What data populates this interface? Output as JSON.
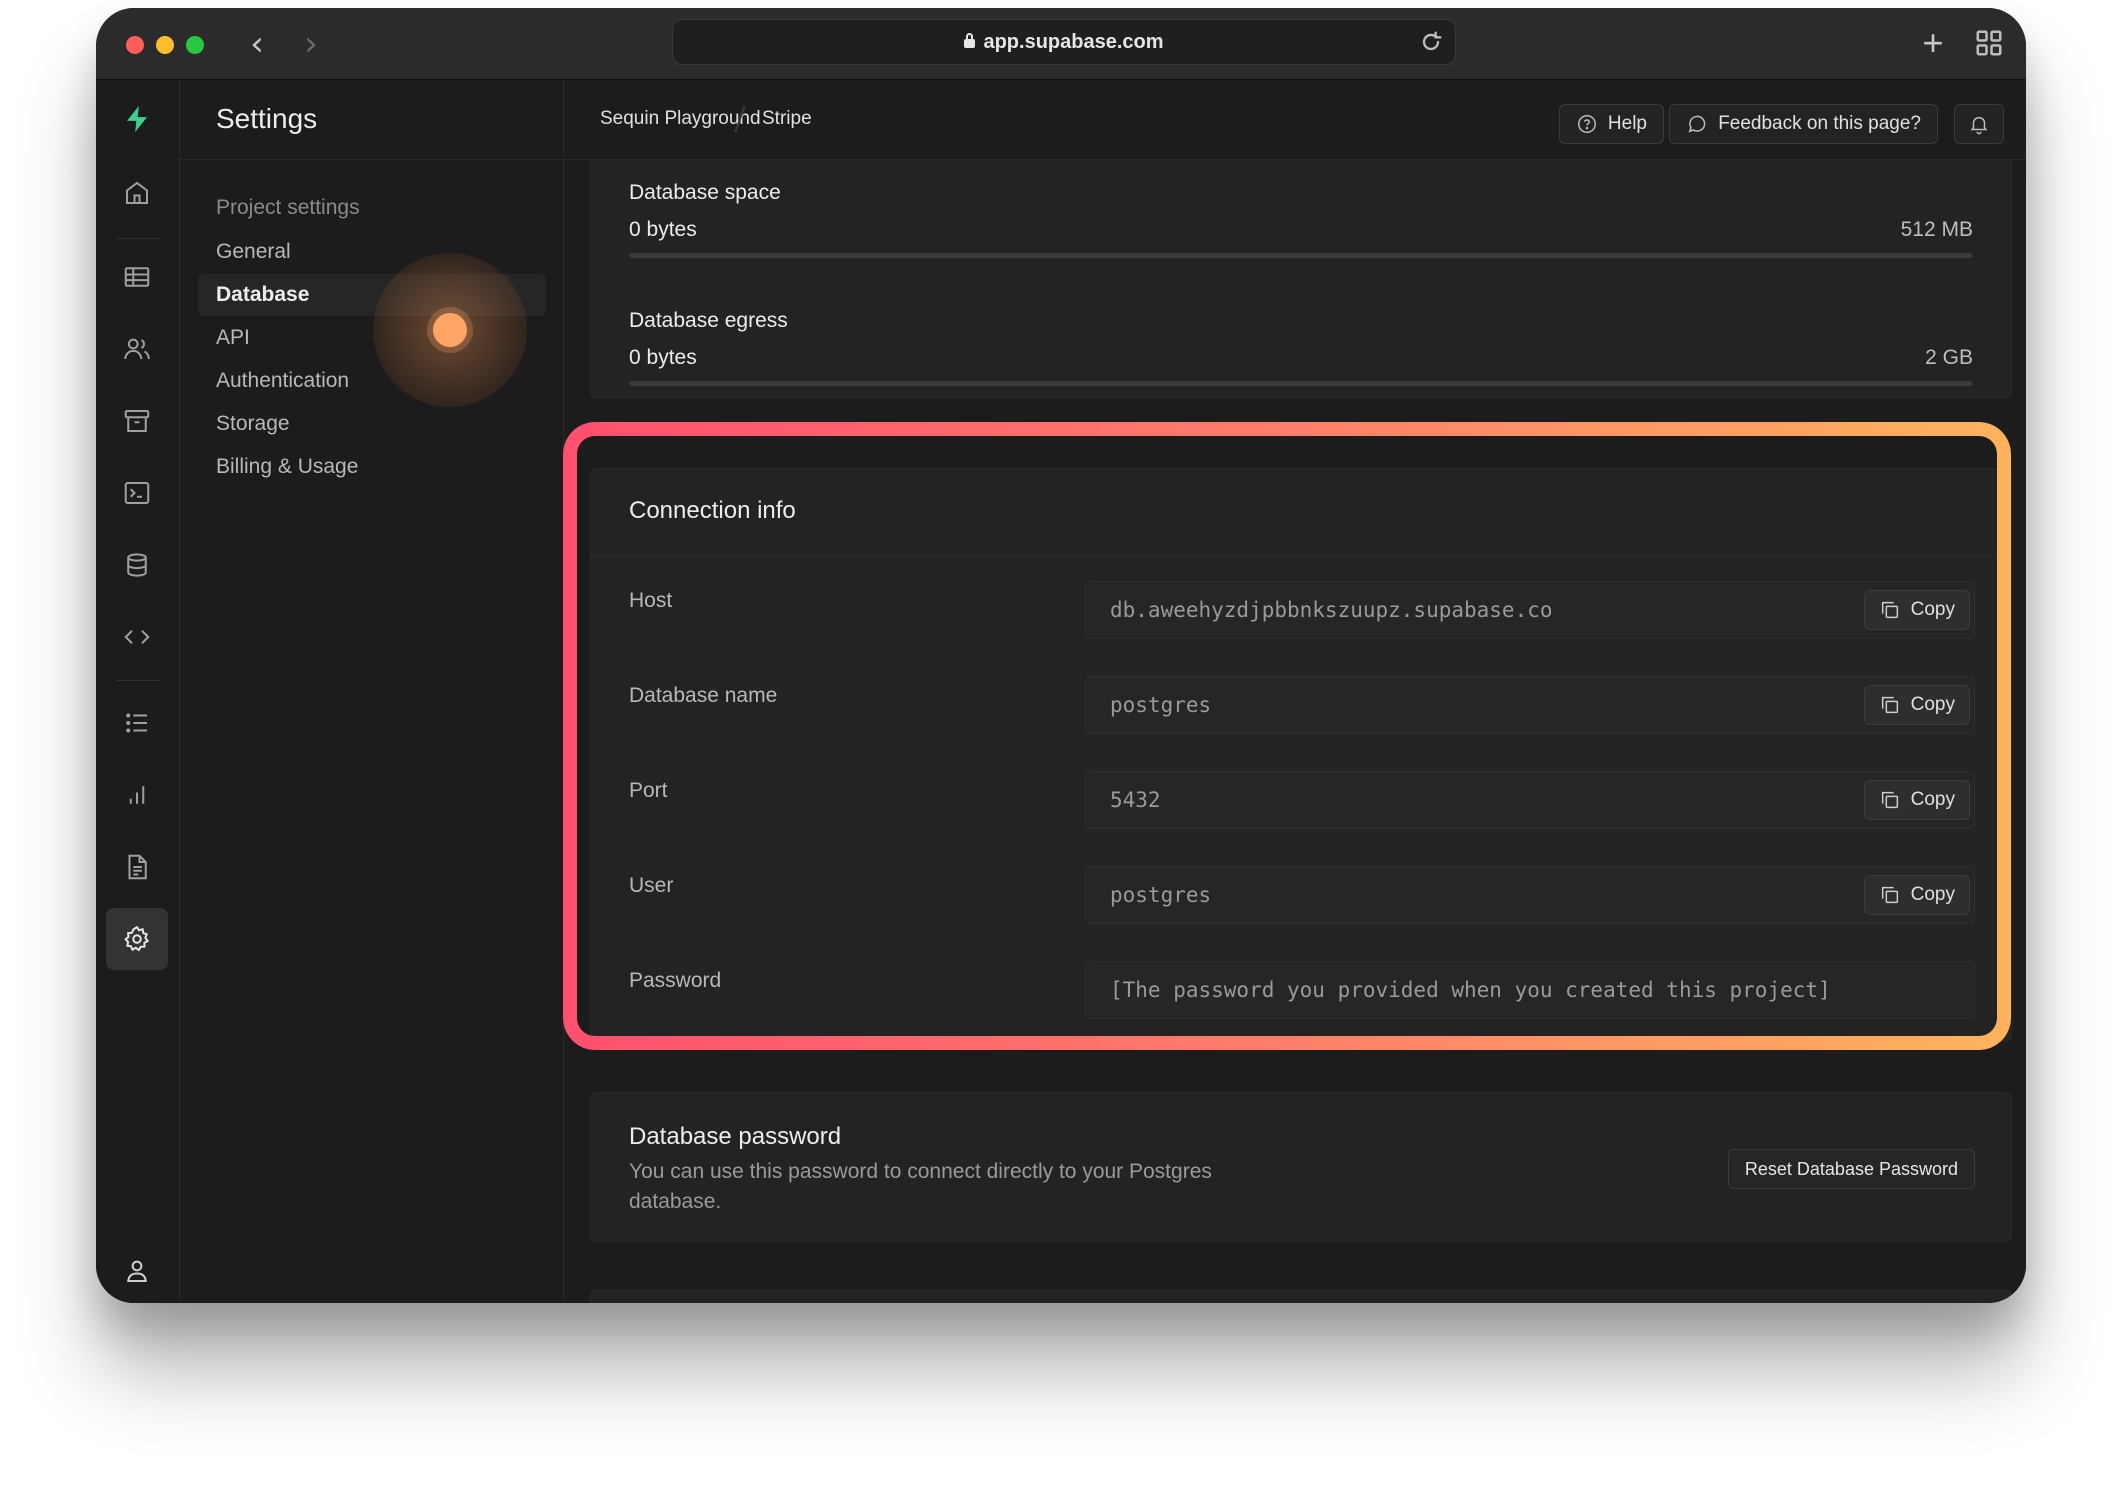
{
  "browser": {
    "url": "app.supabase.com"
  },
  "sidebar": {
    "title": "Settings",
    "section_label": "Project settings",
    "items": [
      {
        "label": "General"
      },
      {
        "label": "Database"
      },
      {
        "label": "API"
      },
      {
        "label": "Authentication"
      },
      {
        "label": "Storage"
      },
      {
        "label": "Billing & Usage"
      }
    ]
  },
  "topbar": {
    "breadcrumbs": [
      "Sequin Playground",
      "Stripe"
    ],
    "help_label": "Help",
    "feedback_label": "Feedback on this page?"
  },
  "usage": {
    "space": {
      "title": "Database space",
      "value": "0 bytes",
      "max": "512 MB",
      "fraction": 0
    },
    "egress": {
      "title": "Database egress",
      "value": "0 bytes",
      "max": "2 GB",
      "fraction": 0
    }
  },
  "connection": {
    "title": "Connection info",
    "copy_label": "Copy",
    "fields": [
      {
        "label": "Host",
        "value": "db.aweehyzdjpbbnkszuupz.supabase.co"
      },
      {
        "label": "Database name",
        "value": "postgres"
      },
      {
        "label": "Port",
        "value": "5432"
      },
      {
        "label": "User",
        "value": "postgres"
      },
      {
        "label": "Password",
        "value": "[The password you provided when you created this project]"
      }
    ]
  },
  "db_password": {
    "title": "Database password",
    "description": "You can use this password to connect directly to your Postgres database.",
    "reset_label": "Reset Database Password"
  },
  "colors": {
    "brand": "#3ecf8e",
    "highlight_start": "#ff4f6e",
    "highlight_end": "#ffb35c",
    "click_indicator": "#ffa566"
  },
  "icons": {
    "rail": [
      "home-icon",
      "table-icon",
      "users-icon",
      "archive-icon",
      "terminal-icon",
      "database-icon",
      "code-icon",
      "list-icon",
      "bar-chart-icon",
      "document-icon",
      "gear-icon"
    ],
    "rail_bottom": "user-icon"
  }
}
